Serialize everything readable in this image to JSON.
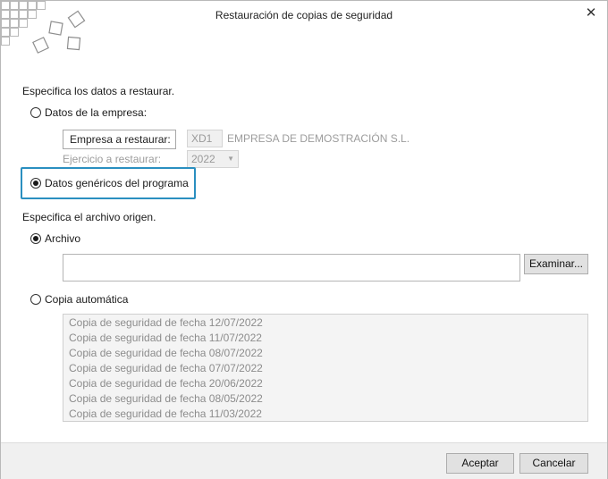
{
  "window": {
    "title": "Restauración de copias de seguridad",
    "close_glyph": "✕"
  },
  "section1": {
    "heading": "Especifica los datos a restaurar.",
    "option_empresa_label": "Datos de la empresa:",
    "empresa_button_label": "Empresa a restaurar:",
    "empresa_code": "XD1",
    "empresa_name": "EMPRESA DE DEMOSTRACIÓN S.L.",
    "ejercicio_label": "Ejercicio a restaurar:",
    "ejercicio_value": "2022",
    "option_genericos_label": "Datos genéricos del programa",
    "selected_option": "genericos"
  },
  "section2": {
    "heading": "Especifica el archivo origen.",
    "option_archivo_label": "Archivo",
    "archivo_value": "",
    "examinar_label": "Examinar...",
    "option_copia_label": "Copia automática",
    "selected_option": "archivo",
    "copias": [
      "Copia de seguridad de fecha 12/07/2022",
      "Copia de seguridad de fecha 11/07/2022",
      "Copia de seguridad de fecha 08/07/2022",
      "Copia de seguridad de fecha 07/07/2022",
      "Copia de seguridad de fecha 20/06/2022",
      "Copia de seguridad de fecha 08/05/2022",
      "Copia de seguridad de fecha 11/03/2022"
    ]
  },
  "footer": {
    "aceptar_label": "Aceptar",
    "cancelar_label": "Cancelar"
  },
  "colors": {
    "highlight": "#2a8fc0",
    "button_bg": "#e1e1e1"
  },
  "icons": {
    "logo": "tiles-logo-icon",
    "close": "close-icon",
    "dropdown": "chevron-down-icon"
  }
}
